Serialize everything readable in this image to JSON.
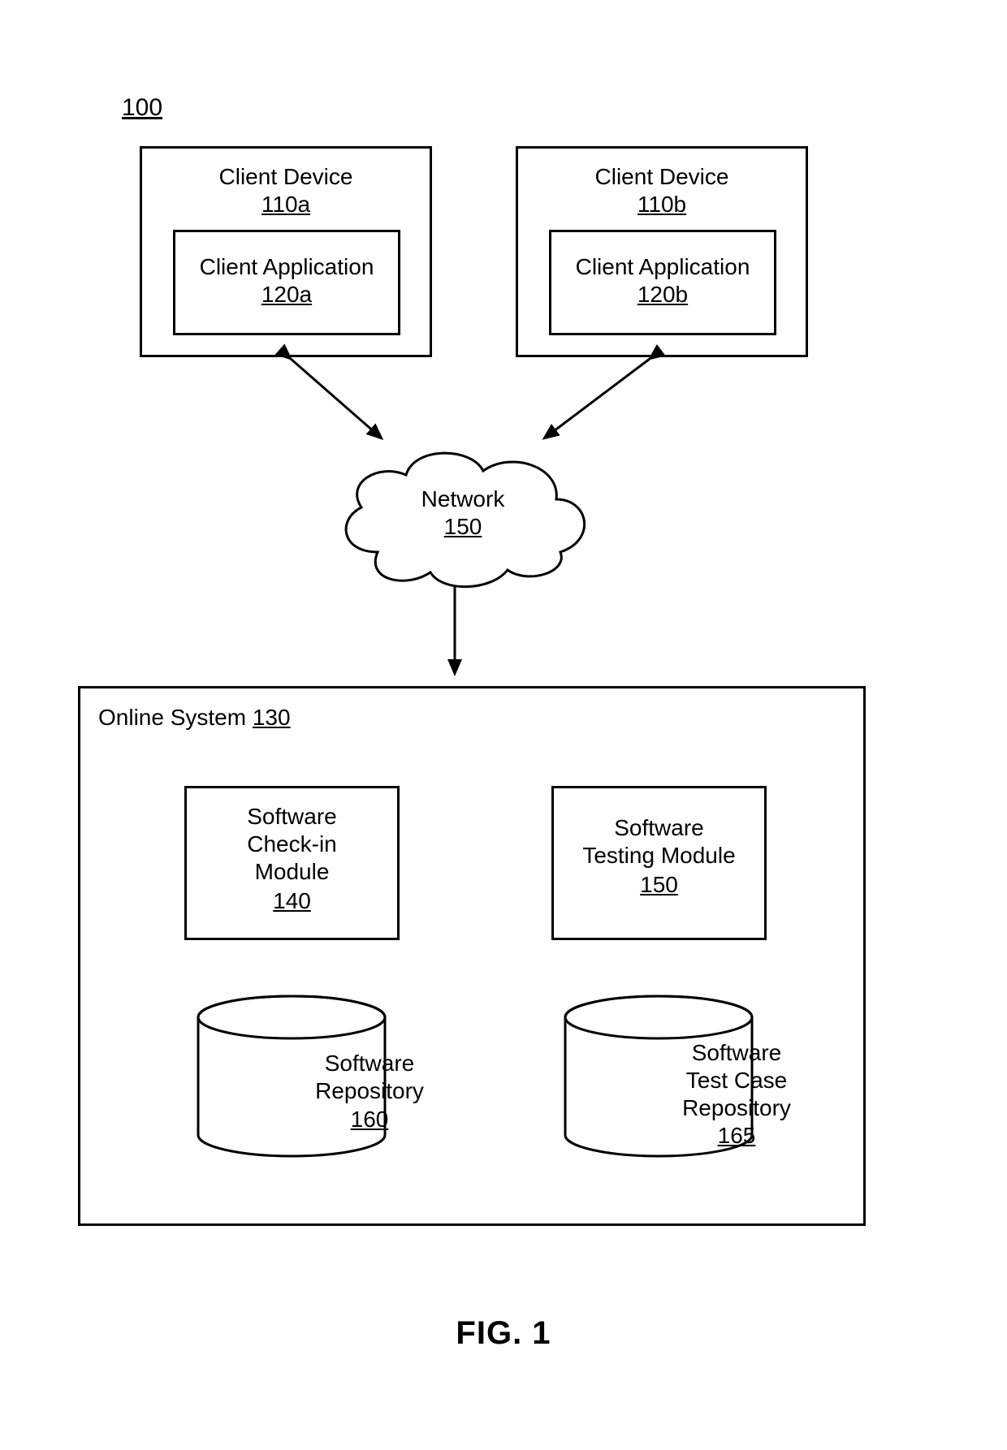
{
  "figure_ref": "100",
  "caption": "FIG. 1",
  "client_a": {
    "device_label": "Client Device",
    "device_ref": "110a",
    "app_label": "Client Application",
    "app_ref": "120a"
  },
  "client_b": {
    "device_label": "Client Device",
    "device_ref": "110b",
    "app_label": "Client Application",
    "app_ref": "120b"
  },
  "network": {
    "label": "Network",
    "ref": "150"
  },
  "online_system": {
    "label": "Online System",
    "ref": "130",
    "checkin_module": {
      "l1": "Software",
      "l2": "Check-in",
      "l3": "Module",
      "ref": "140"
    },
    "testing_module": {
      "l1": "Software",
      "l2": "Testing Module",
      "ref": "150"
    },
    "software_repo": {
      "l1": "Software",
      "l2": "Repository",
      "ref": "160"
    },
    "testcase_repo": {
      "l1": "Software",
      "l2": "Test Case",
      "l3": "Repository",
      "ref": "165"
    }
  }
}
